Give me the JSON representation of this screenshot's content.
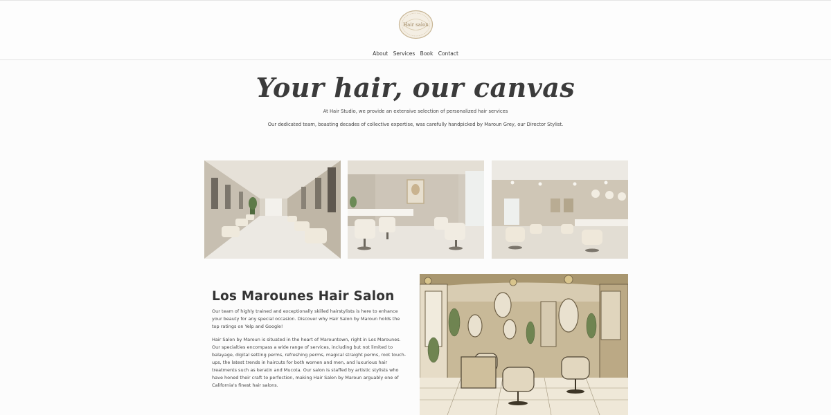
{
  "header": {
    "logo_text": "Hair salon",
    "nav": [
      "About",
      "Services",
      "Book",
      "Contact"
    ]
  },
  "hero": {
    "title": "Your hair, our canvas",
    "line1": "At Hair Studio, we provide an extensive selection of personalized hair services",
    "line2": "Our dedicated team, boasting decades of collective expertise, was carefully handpicked by Maroun Grey, our Director Stylist."
  },
  "gallery": [
    "salon-interior-photo-1",
    "salon-interior-photo-2",
    "salon-interior-photo-3"
  ],
  "about": {
    "title": "Los Marounes Hair Salon",
    "p1": "Our team of highly trained and exceptionally skilled hairstylists is here to enhance your beauty for any special occasion. Discover why Hair Salon by Maroun holds the top ratings on Yelp and Google!",
    "p2": "Hair Salon by Maroun is situated in the heart of Marountown, right in Los Marounes. Our specialties encompass a wide range of services, including but not limited to balayage, digital setting perms, refreshing perms, magical straight perms, root touch-ups, the latest trends in haircuts for both women and men, and luxurious hair treatments such as keratin and Mucota. Our salon is staffed by artistic stylists who have honed their craft to perfection, making Hair Salon by Maroun arguably one of California's finest hair salons."
  },
  "colors": {
    "accent_gold": "#bfa985",
    "illustration_tan": "#b6a584",
    "text": "#3a3a3a"
  }
}
